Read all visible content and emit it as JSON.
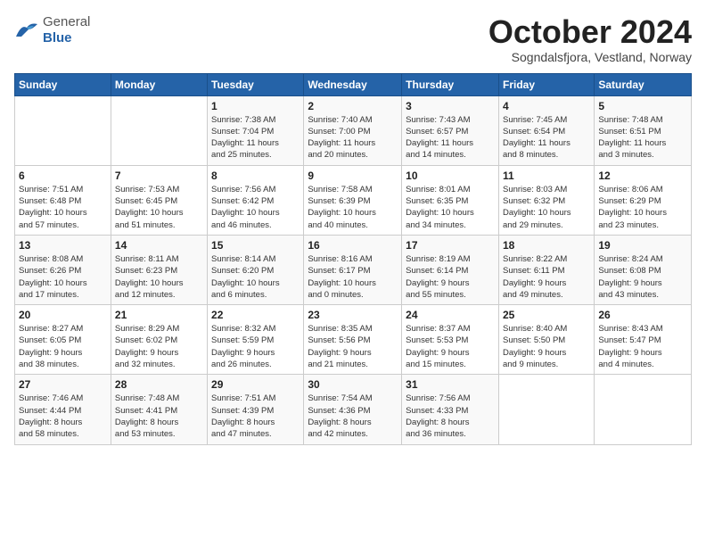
{
  "logo": {
    "general": "General",
    "blue": "Blue"
  },
  "title": "October 2024",
  "subtitle": "Sogndalsfjora, Vestland, Norway",
  "days_header": [
    "Sunday",
    "Monday",
    "Tuesday",
    "Wednesday",
    "Thursday",
    "Friday",
    "Saturday"
  ],
  "weeks": [
    [
      {
        "day": "",
        "info": ""
      },
      {
        "day": "",
        "info": ""
      },
      {
        "day": "1",
        "info": "Sunrise: 7:38 AM\nSunset: 7:04 PM\nDaylight: 11 hours\nand 25 minutes."
      },
      {
        "day": "2",
        "info": "Sunrise: 7:40 AM\nSunset: 7:00 PM\nDaylight: 11 hours\nand 20 minutes."
      },
      {
        "day": "3",
        "info": "Sunrise: 7:43 AM\nSunset: 6:57 PM\nDaylight: 11 hours\nand 14 minutes."
      },
      {
        "day": "4",
        "info": "Sunrise: 7:45 AM\nSunset: 6:54 PM\nDaylight: 11 hours\nand 8 minutes."
      },
      {
        "day": "5",
        "info": "Sunrise: 7:48 AM\nSunset: 6:51 PM\nDaylight: 11 hours\nand 3 minutes."
      }
    ],
    [
      {
        "day": "6",
        "info": "Sunrise: 7:51 AM\nSunset: 6:48 PM\nDaylight: 10 hours\nand 57 minutes."
      },
      {
        "day": "7",
        "info": "Sunrise: 7:53 AM\nSunset: 6:45 PM\nDaylight: 10 hours\nand 51 minutes."
      },
      {
        "day": "8",
        "info": "Sunrise: 7:56 AM\nSunset: 6:42 PM\nDaylight: 10 hours\nand 46 minutes."
      },
      {
        "day": "9",
        "info": "Sunrise: 7:58 AM\nSunset: 6:39 PM\nDaylight: 10 hours\nand 40 minutes."
      },
      {
        "day": "10",
        "info": "Sunrise: 8:01 AM\nSunset: 6:35 PM\nDaylight: 10 hours\nand 34 minutes."
      },
      {
        "day": "11",
        "info": "Sunrise: 8:03 AM\nSunset: 6:32 PM\nDaylight: 10 hours\nand 29 minutes."
      },
      {
        "day": "12",
        "info": "Sunrise: 8:06 AM\nSunset: 6:29 PM\nDaylight: 10 hours\nand 23 minutes."
      }
    ],
    [
      {
        "day": "13",
        "info": "Sunrise: 8:08 AM\nSunset: 6:26 PM\nDaylight: 10 hours\nand 17 minutes."
      },
      {
        "day": "14",
        "info": "Sunrise: 8:11 AM\nSunset: 6:23 PM\nDaylight: 10 hours\nand 12 minutes."
      },
      {
        "day": "15",
        "info": "Sunrise: 8:14 AM\nSunset: 6:20 PM\nDaylight: 10 hours\nand 6 minutes."
      },
      {
        "day": "16",
        "info": "Sunrise: 8:16 AM\nSunset: 6:17 PM\nDaylight: 10 hours\nand 0 minutes."
      },
      {
        "day": "17",
        "info": "Sunrise: 8:19 AM\nSunset: 6:14 PM\nDaylight: 9 hours\nand 55 minutes."
      },
      {
        "day": "18",
        "info": "Sunrise: 8:22 AM\nSunset: 6:11 PM\nDaylight: 9 hours\nand 49 minutes."
      },
      {
        "day": "19",
        "info": "Sunrise: 8:24 AM\nSunset: 6:08 PM\nDaylight: 9 hours\nand 43 minutes."
      }
    ],
    [
      {
        "day": "20",
        "info": "Sunrise: 8:27 AM\nSunset: 6:05 PM\nDaylight: 9 hours\nand 38 minutes."
      },
      {
        "day": "21",
        "info": "Sunrise: 8:29 AM\nSunset: 6:02 PM\nDaylight: 9 hours\nand 32 minutes."
      },
      {
        "day": "22",
        "info": "Sunrise: 8:32 AM\nSunset: 5:59 PM\nDaylight: 9 hours\nand 26 minutes."
      },
      {
        "day": "23",
        "info": "Sunrise: 8:35 AM\nSunset: 5:56 PM\nDaylight: 9 hours\nand 21 minutes."
      },
      {
        "day": "24",
        "info": "Sunrise: 8:37 AM\nSunset: 5:53 PM\nDaylight: 9 hours\nand 15 minutes."
      },
      {
        "day": "25",
        "info": "Sunrise: 8:40 AM\nSunset: 5:50 PM\nDaylight: 9 hours\nand 9 minutes."
      },
      {
        "day": "26",
        "info": "Sunrise: 8:43 AM\nSunset: 5:47 PM\nDaylight: 9 hours\nand 4 minutes."
      }
    ],
    [
      {
        "day": "27",
        "info": "Sunrise: 7:46 AM\nSunset: 4:44 PM\nDaylight: 8 hours\nand 58 minutes."
      },
      {
        "day": "28",
        "info": "Sunrise: 7:48 AM\nSunset: 4:41 PM\nDaylight: 8 hours\nand 53 minutes."
      },
      {
        "day": "29",
        "info": "Sunrise: 7:51 AM\nSunset: 4:39 PM\nDaylight: 8 hours\nand 47 minutes."
      },
      {
        "day": "30",
        "info": "Sunrise: 7:54 AM\nSunset: 4:36 PM\nDaylight: 8 hours\nand 42 minutes."
      },
      {
        "day": "31",
        "info": "Sunrise: 7:56 AM\nSunset: 4:33 PM\nDaylight: 8 hours\nand 36 minutes."
      },
      {
        "day": "",
        "info": ""
      },
      {
        "day": "",
        "info": ""
      }
    ]
  ]
}
